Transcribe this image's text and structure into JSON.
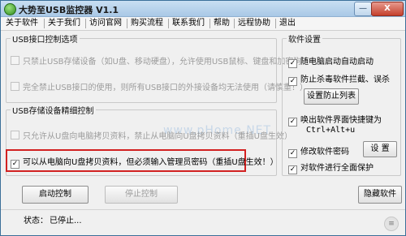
{
  "window": {
    "title": "大势至USB监控器 V1.1",
    "min_label": "—",
    "close_label": "X"
  },
  "menu": [
    "关于软件",
    "关于我们",
    "访问官网",
    "购买流程",
    "联系我们",
    "帮助",
    "远程协助",
    "退出"
  ],
  "usb_control": {
    "title": "USB接口控制选项",
    "opt1": "只禁止USB存储设备（如U盘、移动硬盘），允许使用USB鼠标、键盘和加密狗",
    "opt2": "完全禁止USB接口的使用，则所有USB接口的外接设备均无法使用（请慎重！）"
  },
  "storage_control": {
    "title": "USB存储设备精细控制",
    "opt1": "只允许从U盘向电脑拷贝资料，禁止从电脑向U盘拷贝资料（重插U盘生效）",
    "opt2_check": "✓",
    "opt2": "可以从电脑向U盘拷贝资料，但必须输入管理员密码（重插U盘生效！）"
  },
  "settings": {
    "title": "软件设置",
    "autostart": "随电脑启动自动启动",
    "prevent_kill": "防止杀毒软件拦截、误杀",
    "prevent_list_button": "设置防止列表",
    "hotkey_label": "唤出软件界面快捷键为",
    "hotkey_value": "Ctrl+Alt+u",
    "password_label": "修改软件密码",
    "password_button": "设 置",
    "protect": "对软件进行全面保护",
    "check": "✓"
  },
  "actions": {
    "start": "启动控制",
    "stop": "停止控制",
    "hide": "隐藏软件"
  },
  "status": {
    "label": "状态：",
    "value": "已停止..."
  },
  "watermark": "www.pHome.NET",
  "grip": "≡"
}
